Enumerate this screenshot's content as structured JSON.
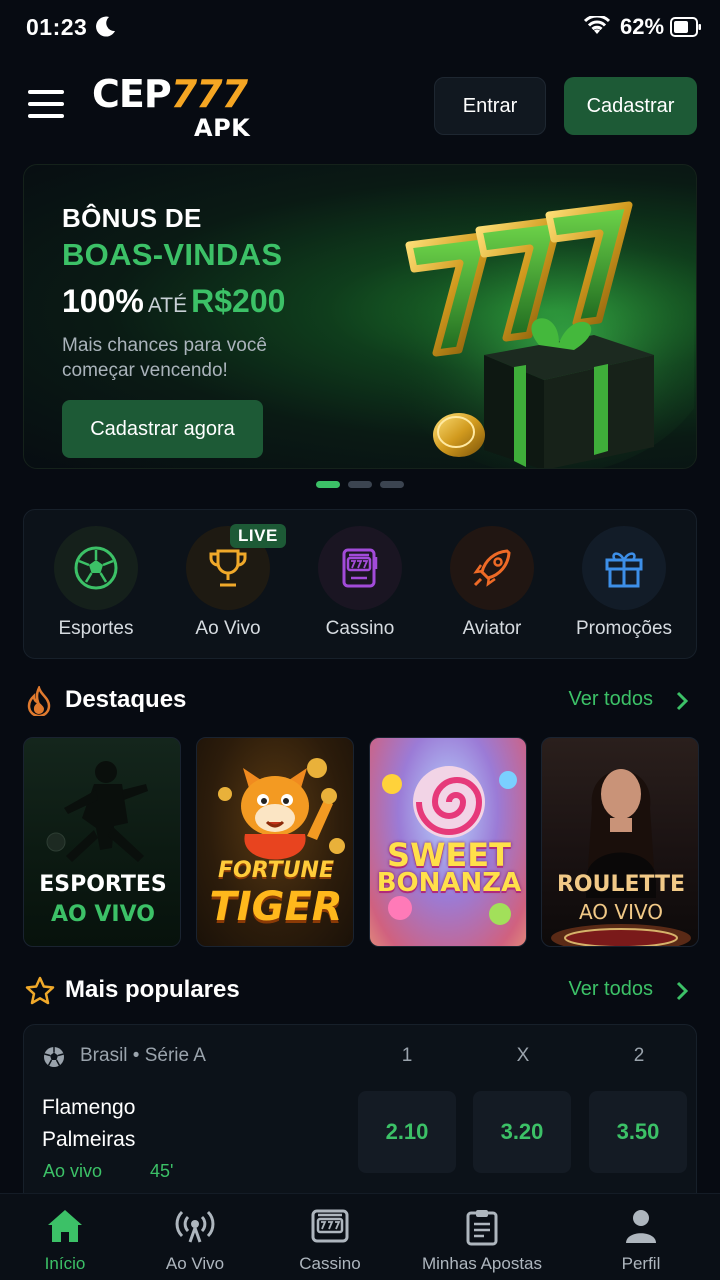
{
  "status_bar": {
    "time": "01:23",
    "battery": "62%"
  },
  "header": {
    "logo_main": "CEP",
    "logo_num": "777",
    "logo_sub": "APK",
    "login_label": "Entrar",
    "signup_label": "Cadastrar"
  },
  "hero": {
    "line1": "BÔNUS DE",
    "line2": "BOAS-VINDAS",
    "percent": "100%",
    "ate": "ATÉ",
    "amount": "R$200",
    "subtitle": "Mais chances para você começar vencendo!",
    "cta_label": "Cadastrar agora",
    "slides_total": 3,
    "slide_active": 1
  },
  "categories": [
    {
      "label": "Esportes",
      "icon": "soccer-ball-icon"
    },
    {
      "label": "Ao Vivo",
      "icon": "trophy-icon",
      "badge": "LIVE"
    },
    {
      "label": "Cassino",
      "icon": "slot-machine-icon"
    },
    {
      "label": "Aviator",
      "icon": "rocket-icon"
    },
    {
      "label": "Promoções",
      "icon": "gift-icon"
    }
  ],
  "highlights": {
    "title": "Destaques",
    "more_label": "Ver todos",
    "cards": [
      {
        "line1": "ESPORTES",
        "line2": "AO VIVO"
      },
      {
        "line1": "FORTUNE",
        "line2": "TIGER"
      },
      {
        "line1": "SWEET",
        "line2": "BONANZA"
      },
      {
        "line1": "ROULETTE",
        "line2": "AO VIVO"
      }
    ]
  },
  "popular": {
    "title": "Mais populares",
    "more_label": "Ver todos",
    "match": {
      "league": "Brasil • Série A",
      "col1": "1",
      "colx": "X",
      "col2": "2",
      "home": "Flamengo",
      "away": "Palmeiras",
      "status": "Ao vivo",
      "minute": "45'",
      "odd1": "2.10",
      "oddx": "3.20",
      "odd2": "3.50"
    }
  },
  "bottom_nav": [
    {
      "label": "Início",
      "icon": "home-icon",
      "active": true
    },
    {
      "label": "Ao Vivo",
      "icon": "broadcast-icon"
    },
    {
      "label": "Cassino",
      "icon": "slot-icon"
    },
    {
      "label": "Minhas Apostas",
      "icon": "clipboard-icon"
    },
    {
      "label": "Perfil",
      "icon": "user-icon"
    }
  ],
  "colors": {
    "accent": "#3cc167",
    "button": "#1d5a36",
    "logo_gold": "#f5a623"
  }
}
